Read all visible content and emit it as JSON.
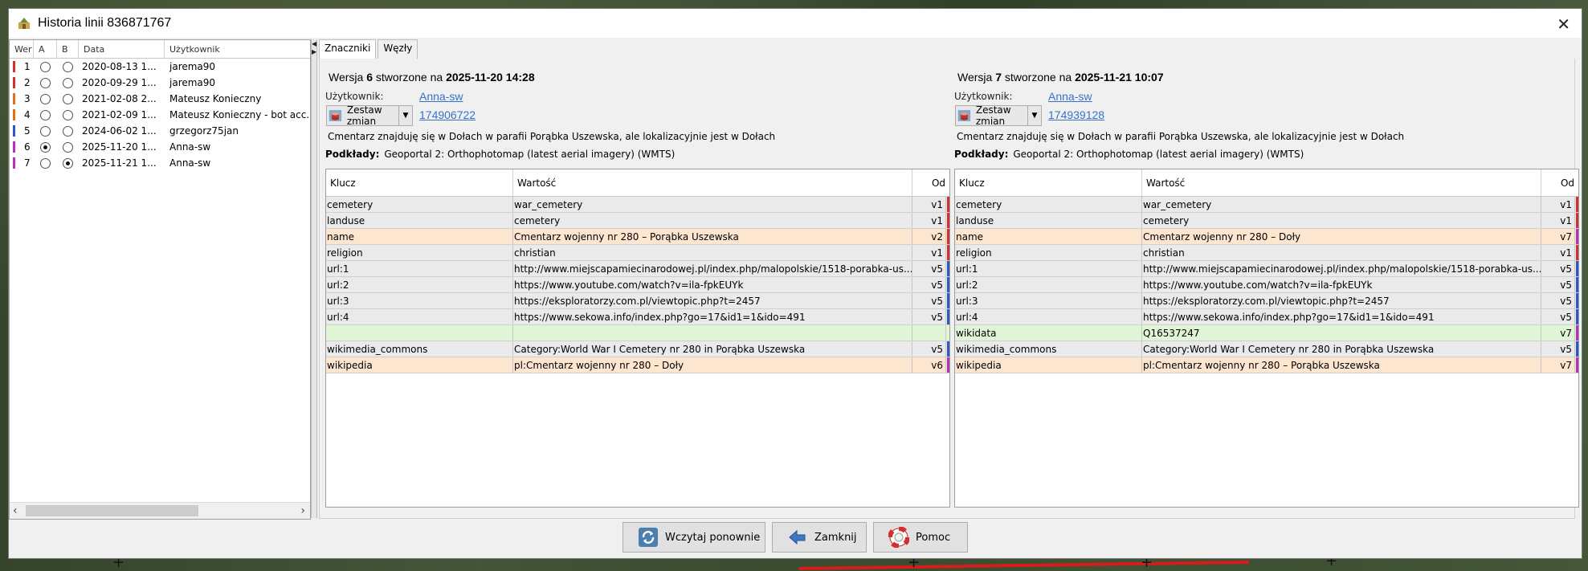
{
  "window": {
    "title": "Historia linii 836871767"
  },
  "history_table": {
    "columns": [
      "Wer",
      "A",
      "B",
      "Data",
      "Użytkownik"
    ],
    "rows": [
      {
        "ver": "1",
        "date": "2020-08-13 1...",
        "user": "jarema90",
        "a": false,
        "b": false,
        "color": "#d32f2f"
      },
      {
        "ver": "2",
        "date": "2020-09-29 1...",
        "user": "jarema90",
        "a": false,
        "b": false,
        "color": "#d32f2f"
      },
      {
        "ver": "3",
        "date": "2021-02-08 2...",
        "user": "Mateusz Konieczny",
        "a": false,
        "b": false,
        "color": "#e0701a"
      },
      {
        "ver": "4",
        "date": "2021-02-09 1...",
        "user": "Mateusz Konieczny - bot acc...",
        "a": false,
        "b": false,
        "color": "#e0701a"
      },
      {
        "ver": "5",
        "date": "2024-06-02 1...",
        "user": "grzegorz75jan",
        "a": false,
        "b": false,
        "color": "#2a56c6"
      },
      {
        "ver": "6",
        "date": "2025-11-20 1...",
        "user": "Anna-sw",
        "a": true,
        "b": false,
        "color": "#b531b8"
      },
      {
        "ver": "7",
        "date": "2025-11-21 1...",
        "user": "Anna-sw",
        "a": false,
        "b": true,
        "color": "#b531b8"
      }
    ]
  },
  "tabs": [
    "Znaczniki",
    "Węzły"
  ],
  "left_version": {
    "prefix": "Wersja",
    "number": "6",
    "mid": "stworzone na",
    "datetime": "2025-11-20 14:28",
    "user_label": "Użytkownik:",
    "user": "Anna-sw",
    "changeset_button": "Zestaw zmian",
    "changeset_id": "174906722",
    "comment": "Cmentarz znajduję się w Dołach w parafii Porąbka Uszewska, ale lokalizacyjnie jest w Dołach",
    "imagery_label": "Podkłady:",
    "imagery": "Geoportal 2: Orthophotomap (latest aerial imagery) (WMTS)",
    "tags": [
      {
        "key": "cemetery",
        "value": "war_cemetery",
        "since": "v1",
        "state": "same",
        "color": "#d32f2f"
      },
      {
        "key": "landuse",
        "value": "cemetery",
        "since": "v1",
        "state": "same",
        "color": "#d32f2f"
      },
      {
        "key": "name",
        "value": "Cmentarz wojenny nr 280 – Porąbka Uszewska",
        "since": "v2",
        "state": "diff",
        "color": "#d32f2f"
      },
      {
        "key": "religion",
        "value": "christian",
        "since": "v1",
        "state": "same",
        "color": "#d32f2f"
      },
      {
        "key": "url:1",
        "value": "http://www.miejscapamiecinarodowej.pl/index.php/malopolskie/1518-porabka-us...",
        "since": "v5",
        "state": "same",
        "color": "#2a56c6"
      },
      {
        "key": "url:2",
        "value": "https://www.youtube.com/watch?v=ila-fpkEUYk",
        "since": "v5",
        "state": "same",
        "color": "#2a56c6"
      },
      {
        "key": "url:3",
        "value": "https://eksploratorzy.com.pl/viewtopic.php?t=2457",
        "since": "v5",
        "state": "same",
        "color": "#2a56c6"
      },
      {
        "key": "url:4",
        "value": "https://www.sekowa.info/index.php?go=17&id1=1&ido=491",
        "since": "v5",
        "state": "same",
        "color": "#2a56c6"
      },
      {
        "key": "",
        "value": "",
        "since": "",
        "state": "add",
        "color": ""
      },
      {
        "key": "wikimedia_commons",
        "value": "Category:World War I Cemetery nr 280 in Porąbka Uszewska",
        "since": "v5",
        "state": "same",
        "color": "#2a56c6"
      },
      {
        "key": "wikipedia",
        "value": "pl:Cmentarz wojenny nr 280 – Doły",
        "since": "v6",
        "state": "diff",
        "color": "#b531b8"
      }
    ]
  },
  "right_version": {
    "prefix": "Wersja",
    "number": "7",
    "mid": "stworzone na",
    "datetime": "2025-11-21 10:07",
    "user_label": "Użytkownik:",
    "user": "Anna-sw",
    "changeset_button": "Zestaw zmian",
    "changeset_id": "174939128",
    "comment": "Cmentarz znajduję się w Dołach w parafii Porąbka Uszewska, ale lokalizacyjnie jest w Dołach",
    "imagery_label": "Podkłady:",
    "imagery": "Geoportal 2: Orthophotomap (latest aerial imagery) (WMTS)",
    "tags": [
      {
        "key": "cemetery",
        "value": "war_cemetery",
        "since": "v1",
        "state": "same",
        "color": "#d32f2f"
      },
      {
        "key": "landuse",
        "value": "cemetery",
        "since": "v1",
        "state": "same",
        "color": "#d32f2f"
      },
      {
        "key": "name",
        "value": "Cmentarz wojenny nr 280 – Doły",
        "since": "v7",
        "state": "diff",
        "color": "#b531b8"
      },
      {
        "key": "religion",
        "value": "christian",
        "since": "v1",
        "state": "same",
        "color": "#d32f2f"
      },
      {
        "key": "url:1",
        "value": "http://www.miejscapamiecinarodowej.pl/index.php/malopolskie/1518-porabka-us...",
        "since": "v5",
        "state": "same",
        "color": "#2a56c6"
      },
      {
        "key": "url:2",
        "value": "https://www.youtube.com/watch?v=ila-fpkEUYk",
        "since": "v5",
        "state": "same",
        "color": "#2a56c6"
      },
      {
        "key": "url:3",
        "value": "https://eksploratorzy.com.pl/viewtopic.php?t=2457",
        "since": "v5",
        "state": "same",
        "color": "#2a56c6"
      },
      {
        "key": "url:4",
        "value": "https://www.sekowa.info/index.php?go=17&id1=1&ido=491",
        "since": "v5",
        "state": "same",
        "color": "#2a56c6"
      },
      {
        "key": "wikidata",
        "value": "Q16537247",
        "since": "v7",
        "state": "add",
        "color": "#b531b8"
      },
      {
        "key": "wikimedia_commons",
        "value": "Category:World War I Cemetery nr 280 in Porąbka Uszewska",
        "since": "v5",
        "state": "same",
        "color": "#2a56c6"
      },
      {
        "key": "wikipedia",
        "value": "pl:Cmentarz wojenny nr 280 – Porąbka Uszewska",
        "since": "v7",
        "state": "diff",
        "color": "#b531b8"
      }
    ]
  },
  "tag_columns": {
    "key": "Klucz",
    "value": "Wartość",
    "since": "Od"
  },
  "buttons": {
    "reload": "Wczytaj ponownie",
    "close": "Zamknij",
    "help": "Pomoc"
  }
}
